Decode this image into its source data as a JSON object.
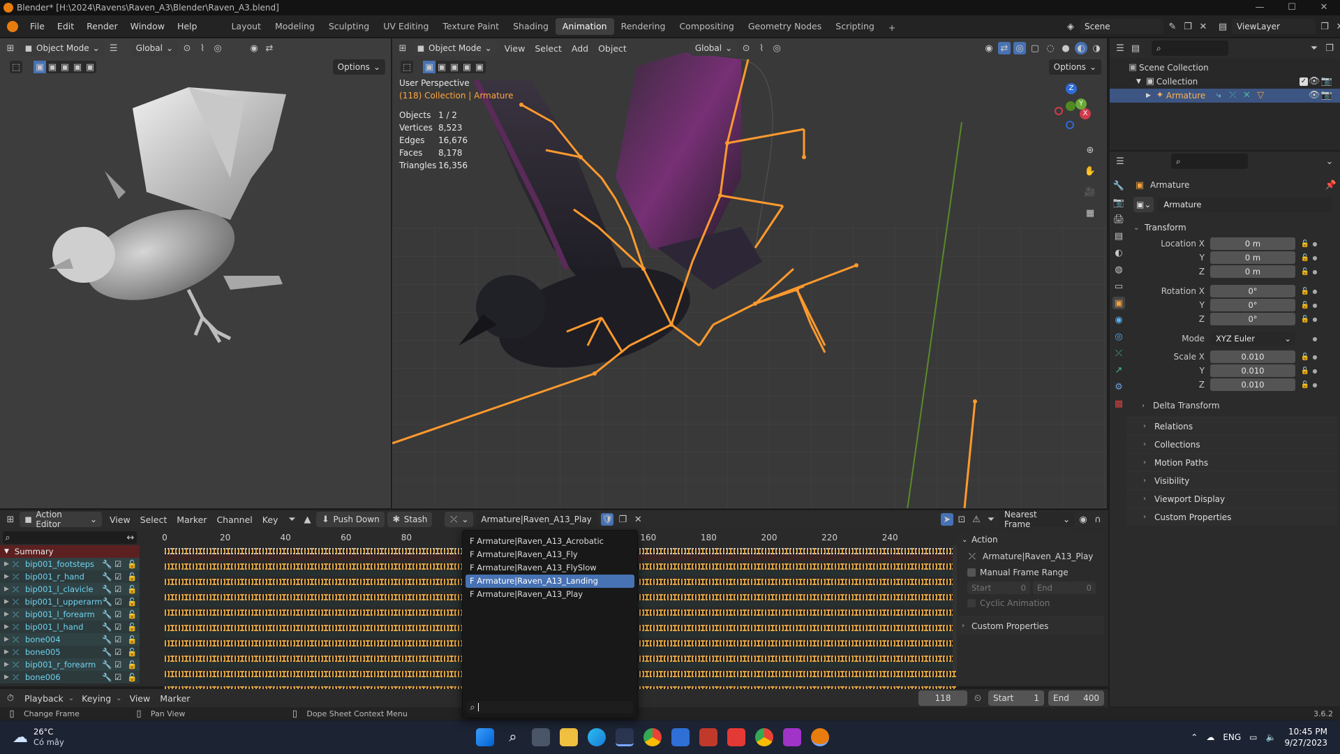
{
  "window": {
    "title": "Blender* [H:\\2024\\Ravens\\Raven_A3\\Blender\\Raven_A3.blend]",
    "min": "—",
    "max": "☐",
    "close": "✕"
  },
  "menubar": {
    "items": [
      "File",
      "Edit",
      "Render",
      "Window",
      "Help"
    ],
    "workspaces": [
      "Layout",
      "Modeling",
      "Sculpting",
      "UV Editing",
      "Texture Paint",
      "Shading",
      "Animation",
      "Rendering",
      "Compositing",
      "Geometry Nodes",
      "Scripting"
    ],
    "active_workspace": "Animation",
    "add_tab": "+",
    "scene": "Scene",
    "view_layer": "ViewLayer"
  },
  "left_viewport": {
    "mode": "Object Mode",
    "orientation": "Global",
    "options": "Options"
  },
  "main_viewport": {
    "mode": "Object Mode",
    "menus": [
      "View",
      "Select",
      "Add",
      "Object"
    ],
    "orientation": "Global",
    "options": "Options",
    "perspective": "User Perspective",
    "collection": "(118) Collection | Armature",
    "stats": [
      {
        "label": "Objects",
        "value": "1 / 2"
      },
      {
        "label": "Vertices",
        "value": "8,523"
      },
      {
        "label": "Edges",
        "value": "16,676"
      },
      {
        "label": "Faces",
        "value": "8,178"
      },
      {
        "label": "Triangles",
        "value": "16,356"
      }
    ],
    "gizmo": {
      "x": "X",
      "y": "Y",
      "z": "Z"
    }
  },
  "outliner": {
    "scene_collection": "Scene Collection",
    "collection": "Collection",
    "armature": "Armature"
  },
  "properties": {
    "object_name": "Armature",
    "data_name": "Armature",
    "transform_title": "Transform",
    "location": [
      {
        "label": "Location X",
        "value": "0 m"
      },
      {
        "label": "Y",
        "value": "0 m"
      },
      {
        "label": "Z",
        "value": "0 m"
      }
    ],
    "rotation": [
      {
        "label": "Rotation X",
        "value": "0°"
      },
      {
        "label": "Y",
        "value": "0°"
      },
      {
        "label": "Z",
        "value": "0°"
      }
    ],
    "mode_label": "Mode",
    "mode_value": "XYZ Euler",
    "scale": [
      {
        "label": "Scale X",
        "value": "0.010"
      },
      {
        "label": "Y",
        "value": "0.010"
      },
      {
        "label": "Z",
        "value": "0.010"
      }
    ],
    "delta_transform": "Delta Transform",
    "sections": [
      "Relations",
      "Collections",
      "Motion Paths",
      "Visibility",
      "Viewport Display",
      "Custom Properties"
    ]
  },
  "action_editor": {
    "mode": "Action Editor",
    "menus": [
      "View",
      "Select",
      "Marker",
      "Channel",
      "Key"
    ],
    "push_down": "Push Down",
    "stash": "Stash",
    "action_name": "Armature|Raven_A13_Play",
    "snap": "Nearest Frame",
    "ruler": [
      "0",
      "20",
      "40",
      "60",
      "80",
      "160",
      "180",
      "200",
      "220",
      "240"
    ],
    "summary": "Summary",
    "channels": [
      "bip001_footsteps",
      "bip001_r_hand",
      "bip001_l_clavicle",
      "bip001_l_upperarm",
      "bip001_l_forearm",
      "bip001_l_hand",
      "bone004",
      "bone005",
      "bip001_r_forearm",
      "bone006"
    ],
    "dropdown_items": [
      {
        "label": "F Armature|Raven_A13_Acrobatic",
        "highlighted": false
      },
      {
        "label": "F Armature|Raven_A13_Fly",
        "highlighted": false
      },
      {
        "label": "F Armature|Raven_A13_FlySlow",
        "highlighted": false
      },
      {
        "label": "F Armature|Raven_A13_Landing",
        "highlighted": true
      },
      {
        "label": "F Armature|Raven_A13_Play",
        "highlighted": false
      }
    ],
    "side_panel": {
      "action_title": "Action",
      "action_name": "Armature|Raven_A13_Play",
      "manual_frame_range": "Manual Frame Range",
      "start_label": "Start",
      "start_value": "0",
      "end_label": "End",
      "end_value": "0",
      "cyclic": "Cyclic Animation",
      "custom_props": "Custom Properties"
    }
  },
  "timeline": {
    "menus": [
      "Playback",
      "Keying",
      "View",
      "Marker"
    ],
    "current_frame": "118",
    "start_label": "Start",
    "start_value": "1",
    "end_label": "End",
    "end_value": "400"
  },
  "statusbar": {
    "change_frame": "Change Frame",
    "pan_view": "Pan View",
    "context_menu": "Dope Sheet Context Menu",
    "version": "3.6.2"
  },
  "taskbar": {
    "temp": "26°C",
    "weather": "Có mây",
    "lang": "ENG",
    "time": "10:45 PM",
    "date": "9/27/2023"
  },
  "colors": {
    "accent": "#4772b3",
    "bone": "#ff9a2e",
    "channel": "#6fd3f0",
    "keyframe": "#e0a342"
  }
}
